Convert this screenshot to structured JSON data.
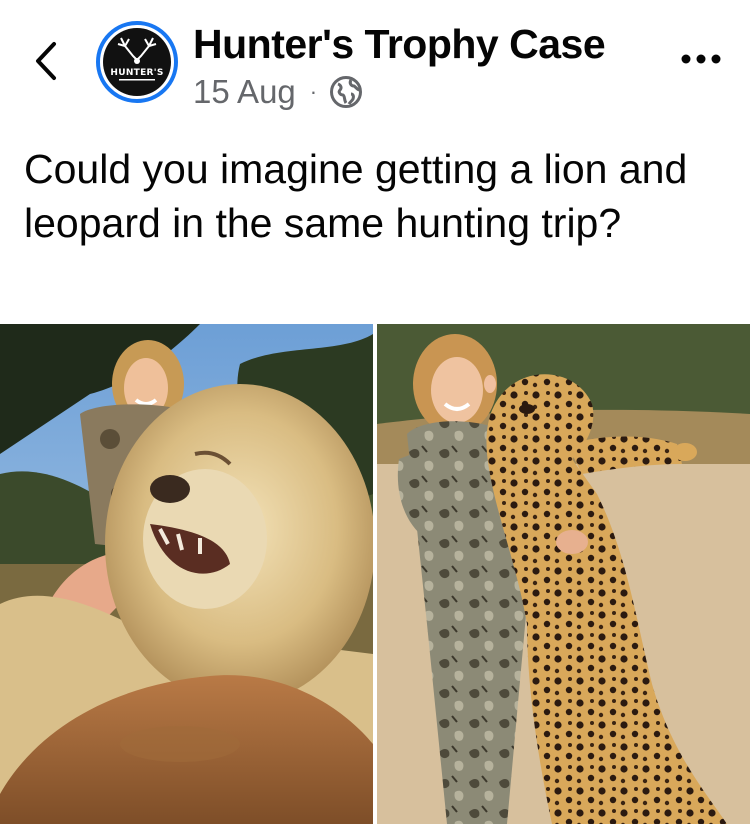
{
  "header": {
    "page_name": "Hunter's Trophy Case",
    "timestamp": "15 Aug",
    "separator": "·",
    "audience_icon": "globe-icon",
    "back_icon": "chevron-left-icon",
    "more_icon": "more-horizontal-icon",
    "avatar_text": "HUNTER'S",
    "accent_color": "#1877f2"
  },
  "post": {
    "caption": "Could you imagine getting a lion and leopard in the same hunting trip?"
  },
  "photos": [
    {
      "subject": "woman posing with lion"
    },
    {
      "subject": "woman holding leopard"
    }
  ]
}
